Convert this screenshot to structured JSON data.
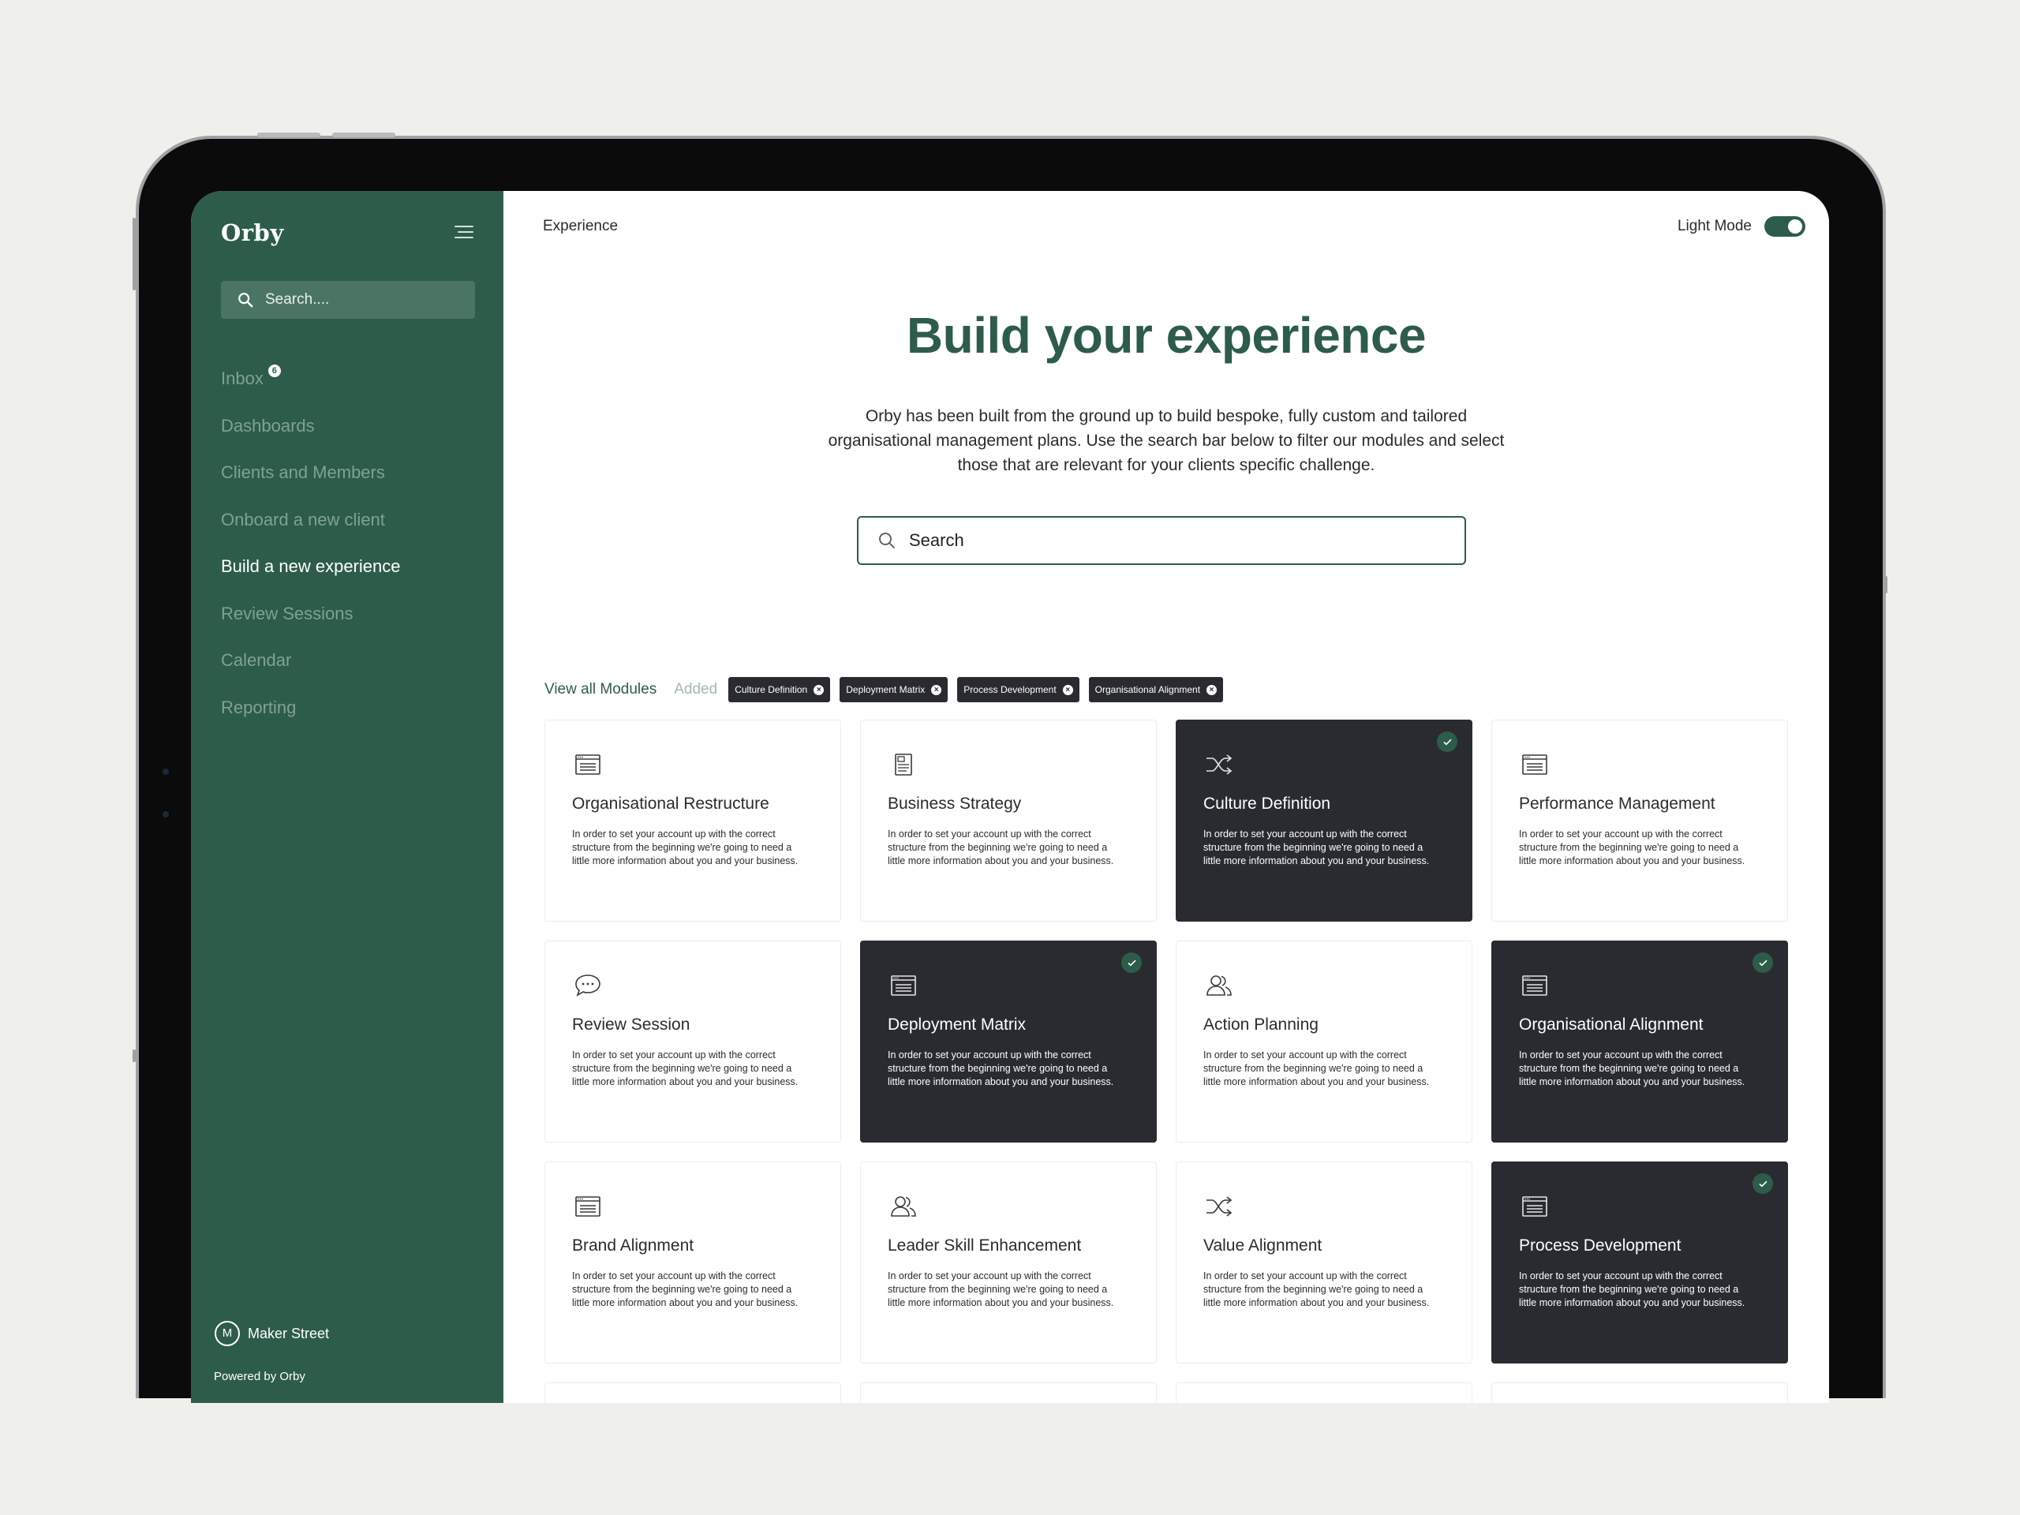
{
  "sidebar": {
    "logo": "Orby",
    "search_placeholder": "Search....",
    "items": [
      {
        "label": "Inbox",
        "badge": "6"
      },
      {
        "label": "Dashboards"
      },
      {
        "label": "Clients and Members"
      },
      {
        "label": "Onboard a new client"
      },
      {
        "label": "Build a new experience",
        "active": true
      },
      {
        "label": "Review Sessions"
      },
      {
        "label": "Calendar"
      },
      {
        "label": "Reporting"
      }
    ],
    "user": {
      "initial": "M",
      "name": "Maker Street"
    },
    "powered_by": "Powered by Orby"
  },
  "header": {
    "breadcrumb": "Experience",
    "light_mode_label": "Light Mode",
    "light_mode_on": true
  },
  "hero": {
    "title": "Build your experience",
    "subtitle": "Orby has been built from the ground up to build bespoke, fully custom and tailored organisational management plans. Use the search bar below to filter our modules and select those that are relevant for your clients specific challenge.",
    "search_placeholder": "Search"
  },
  "filters": {
    "view_all": "View all Modules",
    "added_label": "Added",
    "chips": [
      "Culture Definition",
      "Deployment Matrix",
      "Process Development",
      "Organisational Alignment"
    ]
  },
  "modules": [
    {
      "title": "Organisational Restructure",
      "icon": "document-lines-icon",
      "selected": false,
      "desc": "In order to set your account up with the correct structure from the beginning we're going to need a little more information about you and your business."
    },
    {
      "title": "Business Strategy",
      "icon": "page-icon",
      "selected": false,
      "desc": "In order to set your account up with the correct structure from the beginning we're going to need a little more information about you and your business."
    },
    {
      "title": "Culture Definition",
      "icon": "shuffle-icon",
      "selected": true,
      "desc": "In order to set your account up with the correct structure from the beginning we're going to need a little more information about you and your business."
    },
    {
      "title": "Performance Management",
      "icon": "document-lines-icon",
      "selected": false,
      "desc": "In order to set your account up with the correct structure from the beginning we're going to need a little more information about you and your business."
    },
    {
      "title": "Review Session",
      "icon": "chat-bubble-icon",
      "selected": false,
      "desc": "In order to set your account up with the correct structure from the beginning we're going to need a little more information about you and your business."
    },
    {
      "title": "Deployment Matrix",
      "icon": "document-lines-icon",
      "selected": true,
      "desc": "In order to set your account up with the correct structure from the beginning we're going to need a little more information about you and your business."
    },
    {
      "title": "Action Planning",
      "icon": "users-icon",
      "selected": false,
      "desc": "In order to set your account up with the correct structure from the beginning we're going to need a little more information about you and your business."
    },
    {
      "title": "Organisational Alignment",
      "icon": "document-lines-icon",
      "selected": true,
      "desc": "In order to set your account up with the correct structure from the beginning we're going to need a little more information about you and your business."
    },
    {
      "title": "Brand Alignment",
      "icon": "document-lines-icon",
      "selected": false,
      "desc": "In order to set your account up with the correct structure from the beginning we're going to need a little more information about you and your business."
    },
    {
      "title": "Leader Skill Enhancement",
      "icon": "users-icon",
      "selected": false,
      "desc": "In order to set your account up with the correct structure from the beginning we're going to need a little more information about you and your business."
    },
    {
      "title": "Value Alignment",
      "icon": "shuffle-icon",
      "selected": false,
      "desc": "In order to set your account up with the correct structure from the beginning we're going to need a little more information about you and your business."
    },
    {
      "title": "Process Development",
      "icon": "document-lines-icon",
      "selected": true,
      "desc": "In order to set your account up with the correct structure from the beginning we're going to need a little more information about you and your business."
    }
  ],
  "colors": {
    "brand_green": "#2d5c4a",
    "selected_card": "#2a2b30",
    "nav_muted": "#7fa293"
  }
}
